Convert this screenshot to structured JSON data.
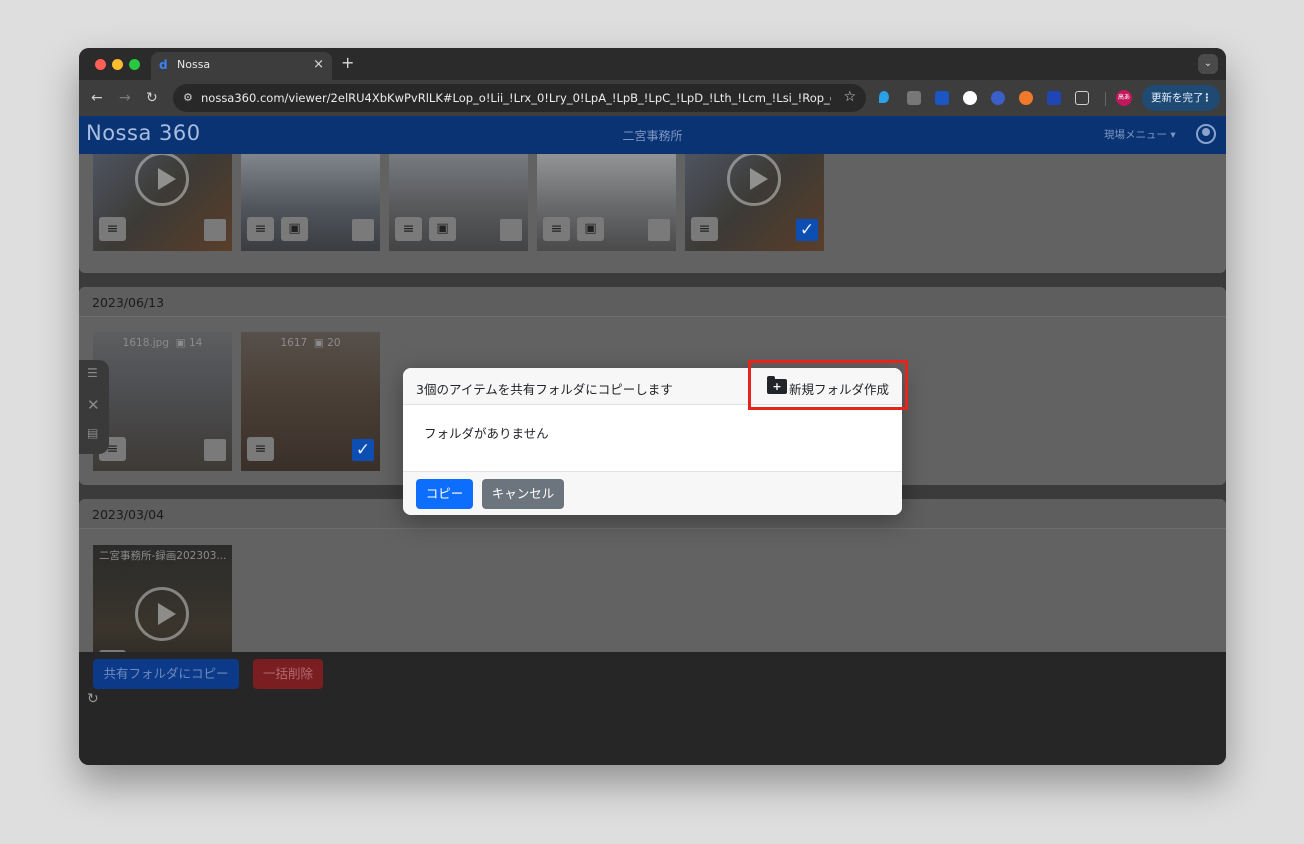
{
  "browser": {
    "tab_title": "Nossa",
    "tab_close": "×",
    "new_tab": "+",
    "url": "nossa360.com/viewer/2elRU4XbKwPvRlLK#Lop_o!Lii_!Lrx_0!Lry_0!LpA_!LpB_!LpC_!LpD_!Lth_!Lcm_!Lsi_!Rop_c!Rii_!Rr...",
    "profile_label": "高あ",
    "update_button": "更新を完了"
  },
  "app": {
    "logo": "Nossa 360",
    "site_name": "二宮事務所",
    "site_menu": "現場メニュー ▾"
  },
  "sections": [
    {
      "items": [
        {
          "pano": false,
          "checked": false
        },
        {
          "pano": true,
          "checked": false
        },
        {
          "pano": true,
          "checked": false
        },
        {
          "pano": true,
          "checked": false
        },
        {
          "pano": false,
          "checked": true
        }
      ]
    },
    {
      "date": "2023/06/13",
      "items": [
        {
          "name": "1618.jpg",
          "count": "14",
          "checked": false
        },
        {
          "name": "1617",
          "count": "20",
          "checked": true
        }
      ]
    },
    {
      "date": "2023/03/04",
      "items": [
        {
          "name": "二宮事務所-録画202303...",
          "checked": true
        }
      ]
    }
  ],
  "footer": {
    "copy_to_shared": "共有フォルダにコピー",
    "bulk_delete": "一括削除"
  },
  "modal": {
    "title": "3個のアイテムを共有フォルダにコピーします",
    "new_folder": "新規フォルダ作成",
    "empty_message": "フォルダがありません",
    "copy_button": "コピー",
    "cancel_button": "キャンセル"
  },
  "colors": {
    "header_blue": "#0a3373",
    "primary": "#0d6efd",
    "secondary": "#6c757d",
    "highlight_red": "#e5251b"
  }
}
